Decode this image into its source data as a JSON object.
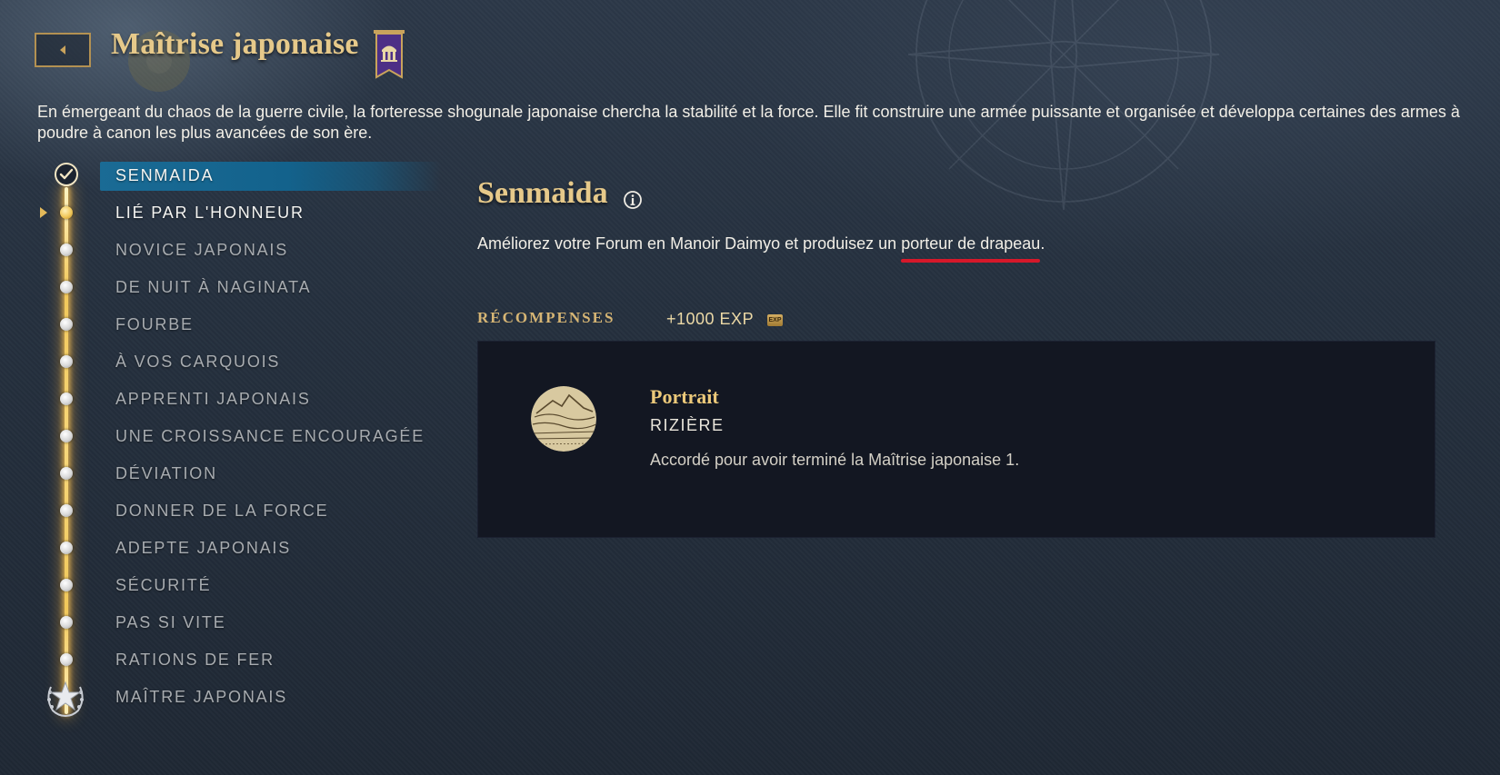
{
  "header": {
    "title": "Maîtrise japonaise",
    "intro": "En émergeant du chaos de la guerre civile, la forteresse shogunale japonaise chercha la stabilité et la force. Elle fit construire une armée puissante et organisée et développa certaines des armes à poudre à canon les plus avancées de son ère.",
    "icons": {
      "back": "chevron-left-icon",
      "banner": "japanese-civ-banner-icon"
    }
  },
  "sidebar": {
    "items": [
      {
        "label": "SENMAIDA",
        "state": "completed"
      },
      {
        "label": "LIÉ PAR L'HONNEUR",
        "state": "current"
      },
      {
        "label": "NOVICE JAPONAIS",
        "state": "locked"
      },
      {
        "label": "DE NUIT À NAGINATA",
        "state": "locked"
      },
      {
        "label": "FOURBE",
        "state": "locked"
      },
      {
        "label": "À VOS CARQUOIS",
        "state": "locked"
      },
      {
        "label": "APPRENTI JAPONAIS",
        "state": "locked"
      },
      {
        "label": "UNE CROISSANCE ENCOURAGÉE",
        "state": "locked"
      },
      {
        "label": "DÉVIATION",
        "state": "locked"
      },
      {
        "label": "DONNER DE LA FORCE",
        "state": "locked"
      },
      {
        "label": "ADEPTE JAPONAIS",
        "state": "locked"
      },
      {
        "label": "SÉCURITÉ",
        "state": "locked"
      },
      {
        "label": "PAS SI VITE",
        "state": "locked"
      },
      {
        "label": "RATIONS DE FER",
        "state": "locked"
      },
      {
        "label": "MAÎTRE JAPONAIS",
        "state": "final"
      }
    ]
  },
  "quest": {
    "title": "Senmaida",
    "desc_before": "Améliorez votre Forum en Manoir Daimyo et produisez un ",
    "desc_highlight": "porteur de drapeau",
    "desc_after": ".",
    "rewards_label": "RÉCOMPENSES",
    "exp": "+1000 EXP",
    "exp_badge": "EXP",
    "reward": {
      "name": "Portrait",
      "type": "RIZIÈRE",
      "detail": "Accordé pour avoir terminé la Maîtrise japonaise 1."
    }
  },
  "colors": {
    "title_gold": "#e6c98a",
    "selected_blue": "#13628c",
    "track_gold": "#f2c85a",
    "underline_red": "#d6182a",
    "panel_bg": "#131722"
  }
}
